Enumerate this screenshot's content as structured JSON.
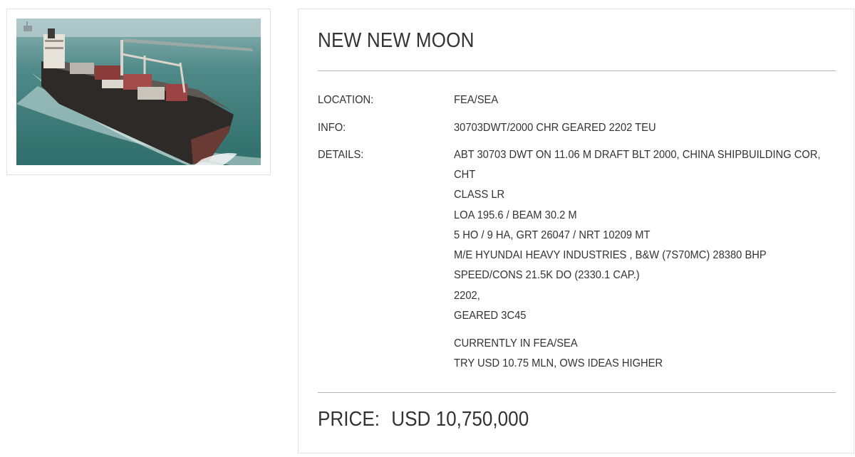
{
  "vessel": {
    "name": "NEW NEW MOON",
    "photo_alt": "container ship"
  },
  "specs": {
    "location_label": "LOCATION:",
    "location_value": "FEA/SEA",
    "info_label": "INFO:",
    "info_value": "30703DWT/2000 CHR GEARED 2202 TEU",
    "details_label": "DETAILS:",
    "details_lines": [
      "ABT 30703 DWT ON 11.06 M DRAFT BLT 2000, CHINA SHIPBUILDING COR,",
      "CHT",
      "CLASS LR",
      "LOA 195.6 / BEAM 30.2 M",
      "5 HO / 9 HA, GRT 26047 / NRT 10209 MT",
      "M/E HYUNDAI HEAVY INDUSTRIES , B&W (7S70MC) 28380 BHP",
      "SPEED/CONS 21.5K DO (2330.1 CAP.)",
      "2202,",
      "GEARED 3C45"
    ],
    "notes": [
      "CURRENTLY IN FEA/SEA",
      "TRY USD 10.75 MLN, OWS IDEAS HIGHER"
    ]
  },
  "price": {
    "label": "PRICE:",
    "value": "USD 10,750,000"
  }
}
